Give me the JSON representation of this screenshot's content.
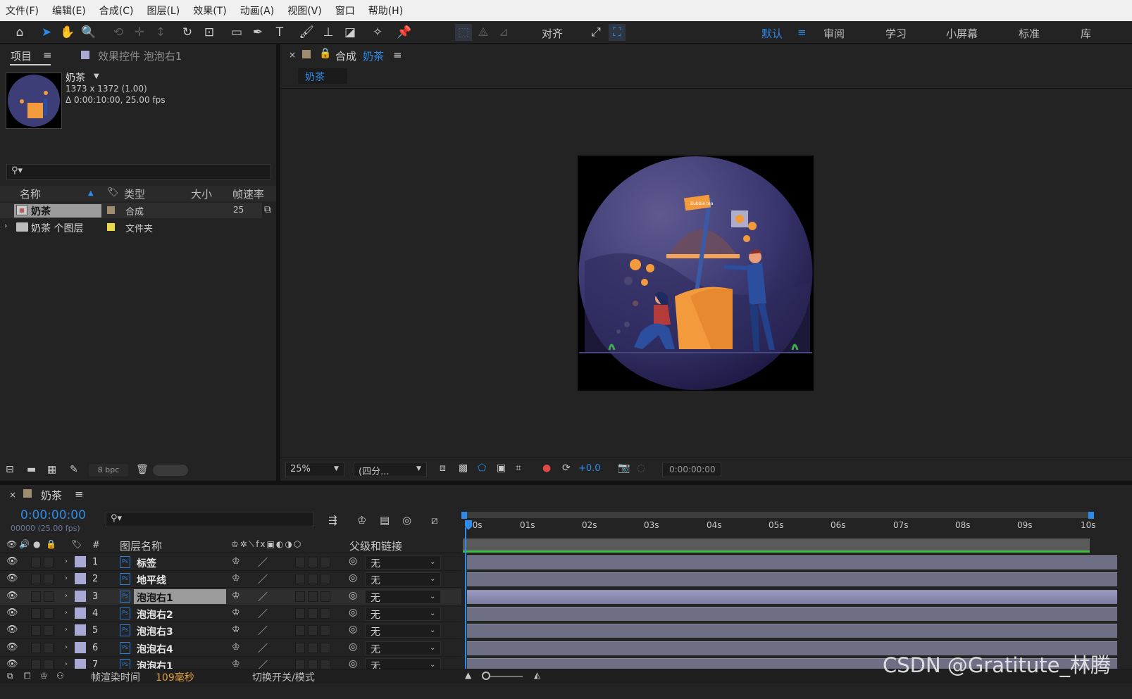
{
  "menu": [
    "文件(F)",
    "编辑(E)",
    "合成(C)",
    "图层(L)",
    "效果(T)",
    "动画(A)",
    "视图(V)",
    "窗口",
    "帮助(H)"
  ],
  "toolbar": {
    "align_label": "对齐",
    "workspaces": [
      "默认",
      "审阅",
      "学习",
      "小屏幕",
      "标准",
      "库"
    ]
  },
  "project": {
    "tab_project": "项目",
    "tab_effects": "效果控件 泡泡右1",
    "comp_name": "奶茶",
    "comp_dims": "1373 x 1372 (1.00)",
    "comp_duration": "Δ 0:00:10:00, 25.00 fps",
    "columns": [
      "名称",
      "类型",
      "大小",
      "帧速率"
    ],
    "items": [
      {
        "name": "奶茶",
        "type": "合成",
        "fps": "25",
        "color": "#a08c6e"
      },
      {
        "name": "奶茶 个图层",
        "type": "文件夹",
        "fps": "",
        "color": "#e8d84a"
      }
    ],
    "bpc": "8 bpc"
  },
  "composition": {
    "tab_prefix": "合成",
    "tab_name": "奶茶",
    "breadcrumb": "奶茶",
    "zoom": "25%",
    "resolution": "(四分...",
    "exposure": "+0.0",
    "timecode": "0:00:00:00",
    "sign_text": "Bubble tea"
  },
  "timeline": {
    "tab_name": "奶茶",
    "current_time": "0:00:00:00",
    "frame_info": "00000 (25.00 fps)",
    "col_layer_name": "图层名称",
    "col_parent": "父级和链接",
    "col_hash": "#",
    "ruler": [
      "00s",
      "01s",
      "02s",
      "03s",
      "04s",
      "05s",
      "06s",
      "07s",
      "08s",
      "09s",
      "10s"
    ],
    "layers": [
      {
        "num": "1",
        "name": "标签",
        "parent": "无"
      },
      {
        "num": "2",
        "name": "地平线",
        "parent": "无"
      },
      {
        "num": "3",
        "name": "泡泡右1",
        "parent": "无"
      },
      {
        "num": "4",
        "name": "泡泡右2",
        "parent": "无"
      },
      {
        "num": "5",
        "name": "泡泡右3",
        "parent": "无"
      },
      {
        "num": "6",
        "name": "泡泡右4",
        "parent": "无"
      },
      {
        "num": "7",
        "name": "泡泡右1",
        "parent": "无"
      }
    ],
    "selected_layer": 3,
    "status_render_label": "帧渲染时间",
    "status_render_value": "109毫秒",
    "status_toggle": "切换开关/模式"
  },
  "watermark": "CSDN @Gratitute_林腾",
  "colors": {
    "accent": "#2d8ceb",
    "layer_label": "#a9a9d6",
    "bar": "#6e6e84"
  }
}
